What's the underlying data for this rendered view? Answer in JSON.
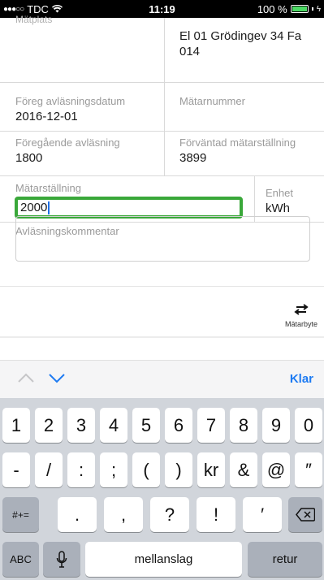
{
  "status_bar": {
    "signal_dots": "●●●○○",
    "carrier": "TDC",
    "wifi_icon": "wifi-icon",
    "time": "11:19",
    "battery_percent": "100 %",
    "battery_level": 1.0
  },
  "form": {
    "measure_place_label": "Mätplats",
    "measure_place_value_line1": "El 01 Grödingev 34 Fa",
    "measure_place_value_line2": "014",
    "prev_date_label": "Föreg avläsningsdatum",
    "prev_date_value": "2016-12-01",
    "meter_number_label": "Mätarnummer",
    "prev_reading_label": "Föregående avläsning",
    "prev_reading_value": "1800",
    "expected_label": "Förväntad mätarställning",
    "expected_value": "3899",
    "reading_label": "Mätarställning",
    "reading_value": "2000",
    "unit_label": "Enhet",
    "unit_value": "kWh",
    "comment_label": "Avläsningskommentar",
    "comment_value": ""
  },
  "actions": {
    "swap_label": "Mätarbyte",
    "swap_icon": "swap-arrows-icon"
  },
  "keyboard_toolbar": {
    "done_label": "Klar"
  },
  "keyboard": {
    "row1": [
      "1",
      "2",
      "3",
      "4",
      "5",
      "6",
      "7",
      "8",
      "9",
      "0"
    ],
    "row2": [
      "-",
      "/",
      ":",
      ";",
      "(",
      ")",
      "kr",
      "&",
      "@",
      "″"
    ],
    "row3_left": "#+=",
    "row3": [
      ".",
      ",",
      "?",
      "!",
      "′"
    ],
    "row4_abc": "ABC",
    "row4_space": "mellanslag",
    "row4_return": "retur"
  }
}
